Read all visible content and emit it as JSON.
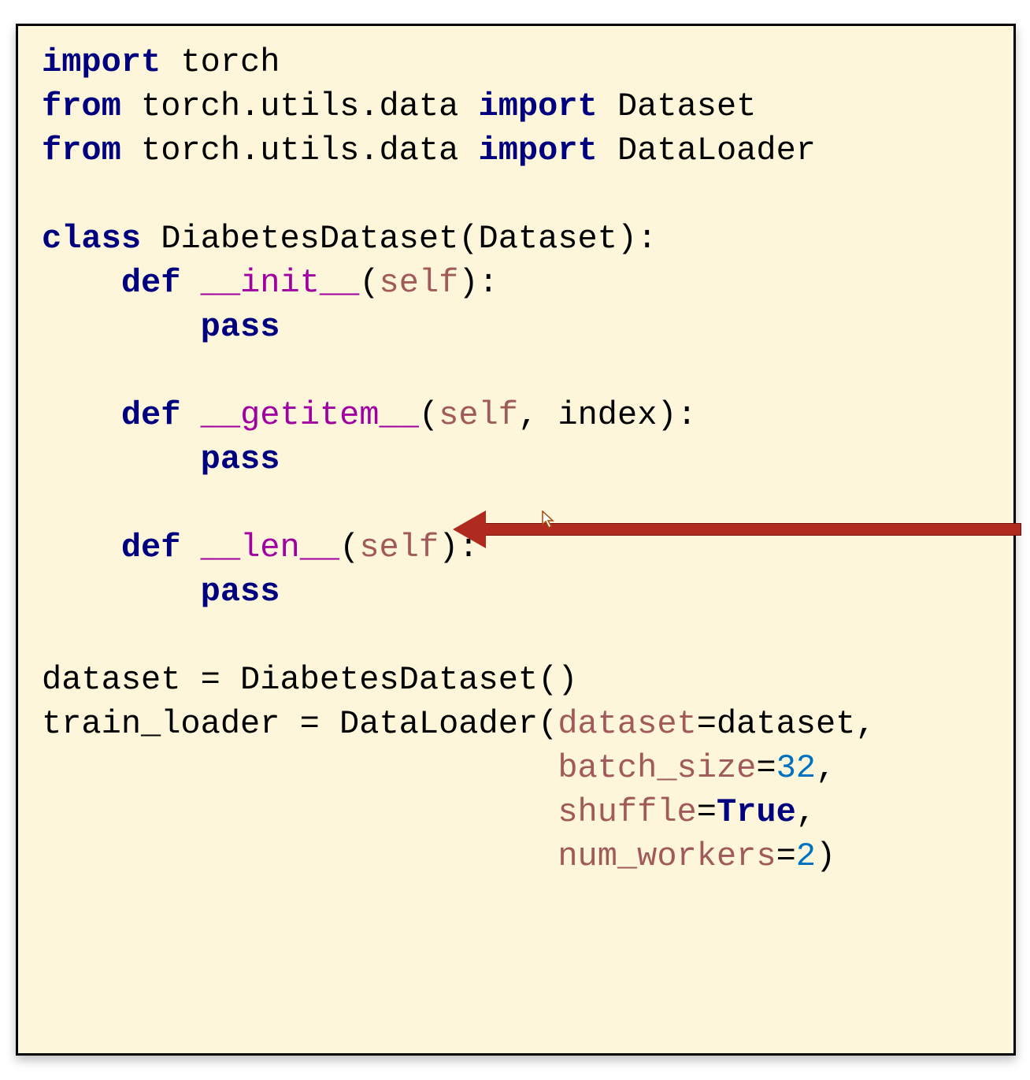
{
  "code": {
    "l1": {
      "kw1": "import",
      "t1": " torch"
    },
    "l2": {
      "kw1": "from",
      "t1": " torch.utils.data ",
      "kw2": "import",
      "t2": " Dataset"
    },
    "l3": {
      "kw1": "from",
      "t1": " torch.utils.data ",
      "kw2": "import",
      "t2": " DataLoader"
    },
    "l5": {
      "kw1": "class",
      "t1": " DiabetesDataset(Dataset):"
    },
    "l6": {
      "indent": "    ",
      "kw1": "def",
      "sp": " ",
      "name": "__init__",
      "open": "(",
      "p1": "self",
      "close": "):"
    },
    "l7": {
      "indent": "        ",
      "kw1": "pass"
    },
    "l9": {
      "indent": "    ",
      "kw1": "def",
      "sp": " ",
      "name": "__getitem__",
      "open": "(",
      "p1": "self",
      "comma": ", ",
      "p2": "index",
      "close": "):"
    },
    "l10": {
      "indent": "        ",
      "kw1": "pass"
    },
    "l12": {
      "indent": "    ",
      "kw1": "def",
      "sp": " ",
      "name": "__len__",
      "open": "(",
      "p1": "self",
      "close": "):"
    },
    "l13": {
      "indent": "        ",
      "kw1": "pass"
    },
    "l15": {
      "t1": "dataset = DiabetesDataset()"
    },
    "l16": {
      "t1": "train_loader = DataLoader(",
      "p1": "dataset",
      "eq": "=dataset,"
    },
    "l17": {
      "indent": "                          ",
      "p1": "batch_size",
      "eq": "=",
      "n1": "32",
      "tail": ","
    },
    "l18": {
      "indent": "                          ",
      "p1": "shuffle",
      "eq": "=",
      "b1": "True",
      "tail": ","
    },
    "l19": {
      "indent": "                          ",
      "p1": "num_workers",
      "eq": "=",
      "n1": "2",
      "tail": ")"
    }
  },
  "annotation": {
    "arrow_target": "__len__",
    "arrow_color": "#b02a1f"
  },
  "cursor": {
    "type": "arrow-pointer"
  }
}
